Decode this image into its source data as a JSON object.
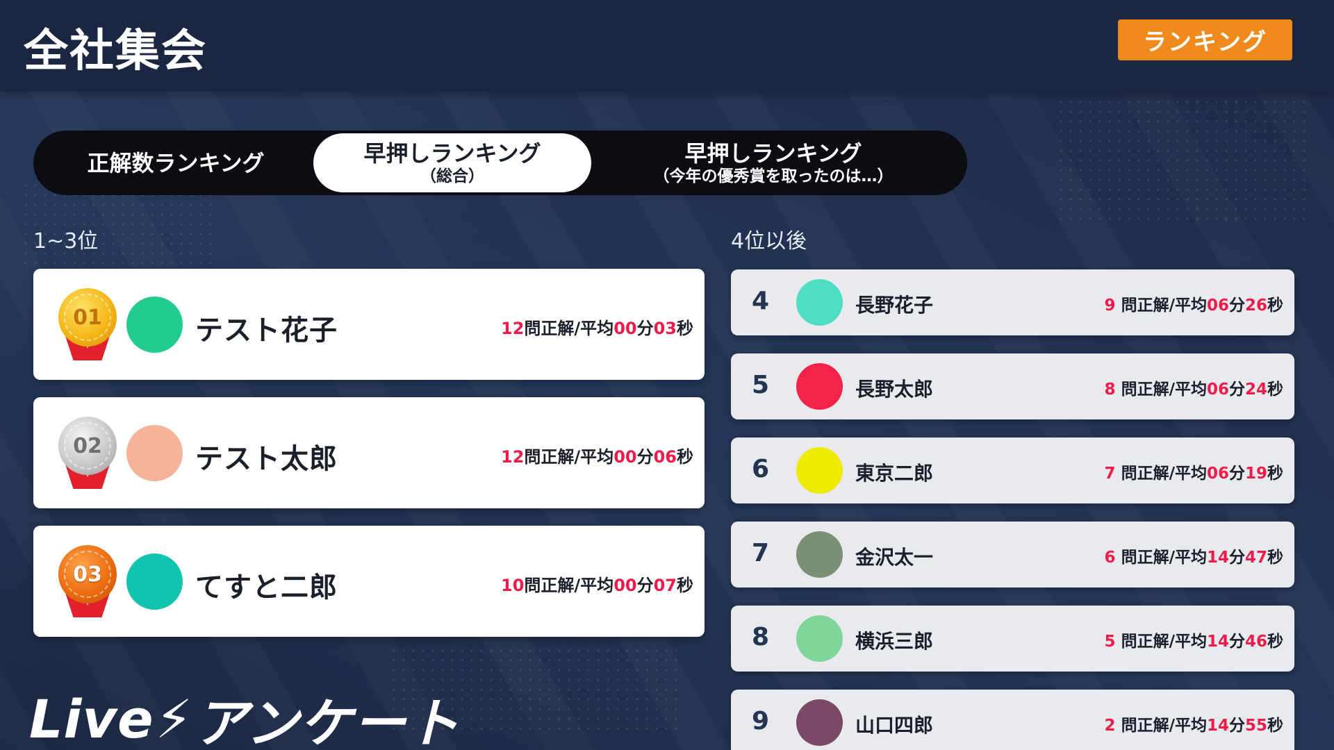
{
  "header": {
    "title": "全社集会",
    "ranking_button": "ランキング"
  },
  "tabs": [
    {
      "label": "正解数ランキング",
      "sub": "",
      "active": false
    },
    {
      "label": "早押しランキング",
      "sub": "（総合）",
      "active": true
    },
    {
      "label": "早押しランキング",
      "sub": "（今年の優秀賞を取ったのは…）",
      "active": false
    }
  ],
  "sections": {
    "top_label": "1~3位",
    "rest_label": "4位以後"
  },
  "top3": [
    {
      "medal": "01",
      "medal_type": "gold",
      "avatar_color": "#21cc8c",
      "name": "テスト花子",
      "correct": "12",
      "min": "00",
      "sec": "03"
    },
    {
      "medal": "02",
      "medal_type": "silver",
      "avatar_color": "#f5b39a",
      "name": "テスト太郎",
      "correct": "12",
      "min": "00",
      "sec": "06"
    },
    {
      "medal": "03",
      "medal_type": "bronze",
      "avatar_color": "#12c4b0",
      "name": "てすと二郎",
      "correct": "10",
      "min": "00",
      "sec": "07"
    }
  ],
  "rest": [
    {
      "rank": "4",
      "avatar_color": "#4fdec4",
      "name": "長野花子",
      "correct": "9",
      "min": "06",
      "sec": "26"
    },
    {
      "rank": "5",
      "avatar_color": "#f5224c",
      "name": "長野太郎",
      "correct": "8",
      "min": "06",
      "sec": "24"
    },
    {
      "rank": "6",
      "avatar_color": "#eeea00",
      "name": "東京二郎",
      "correct": "7",
      "min": "06",
      "sec": "19"
    },
    {
      "rank": "7",
      "avatar_color": "#7b9075",
      "name": "金沢太一",
      "correct": "6",
      "min": "14",
      "sec": "47"
    },
    {
      "rank": "8",
      "avatar_color": "#7fd69a",
      "name": "横浜三郎",
      "correct": "5",
      "min": "14",
      "sec": "46"
    },
    {
      "rank": "9",
      "avatar_color": "#7b4866",
      "name": "山口四郎",
      "correct": "2",
      "min": "14",
      "sec": "55"
    }
  ],
  "stat_labels": {
    "correct_suffix": "問正解/平均",
    "min_suffix": "分",
    "sec_suffix": "秒"
  },
  "logo": {
    "text_live": "Live",
    "bolt": "⚡",
    "text_jp": "アンケート"
  },
  "colors": {
    "accent": "#f08a1c",
    "highlight_red": "#ee1c4a",
    "background": "#1f2b47"
  }
}
